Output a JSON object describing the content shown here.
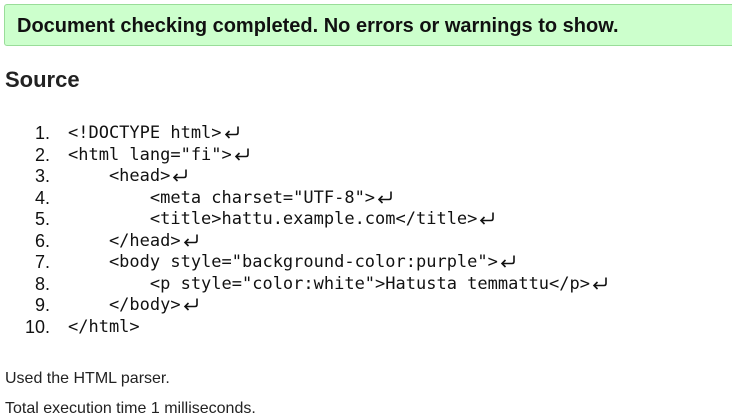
{
  "banner": {
    "text": "Document checking completed. No errors or warnings to show."
  },
  "source": {
    "heading": "Source",
    "lines": [
      {
        "number": "1.",
        "code": "<!DOCTYPE html>"
      },
      {
        "number": "2.",
        "code": "<html lang=\"fi\">"
      },
      {
        "number": "3.",
        "code": "    <head>"
      },
      {
        "number": "4.",
        "code": "        <meta charset=\"UTF-8\">"
      },
      {
        "number": "5.",
        "code": "        <title>hattu.example.com</title>"
      },
      {
        "number": "6.",
        "code": "    </head>"
      },
      {
        "number": "7.",
        "code": "    <body style=\"background-color:purple\">"
      },
      {
        "number": "8.",
        "code": "        <p style=\"color:white\">Hatusta temmattu</p>"
      },
      {
        "number": "9.",
        "code": "    </body>"
      },
      {
        "number": "10.",
        "code": "</html>"
      }
    ],
    "line_end_icon": "line-feed-return-icon",
    "last_line_has_line_end": false
  },
  "notes": {
    "parser": "Used the HTML parser.",
    "execution_time": "Total execution time 1 milliseconds."
  },
  "colors": {
    "banner_background": "#ccffcc",
    "banner_border": "#99dd99"
  }
}
